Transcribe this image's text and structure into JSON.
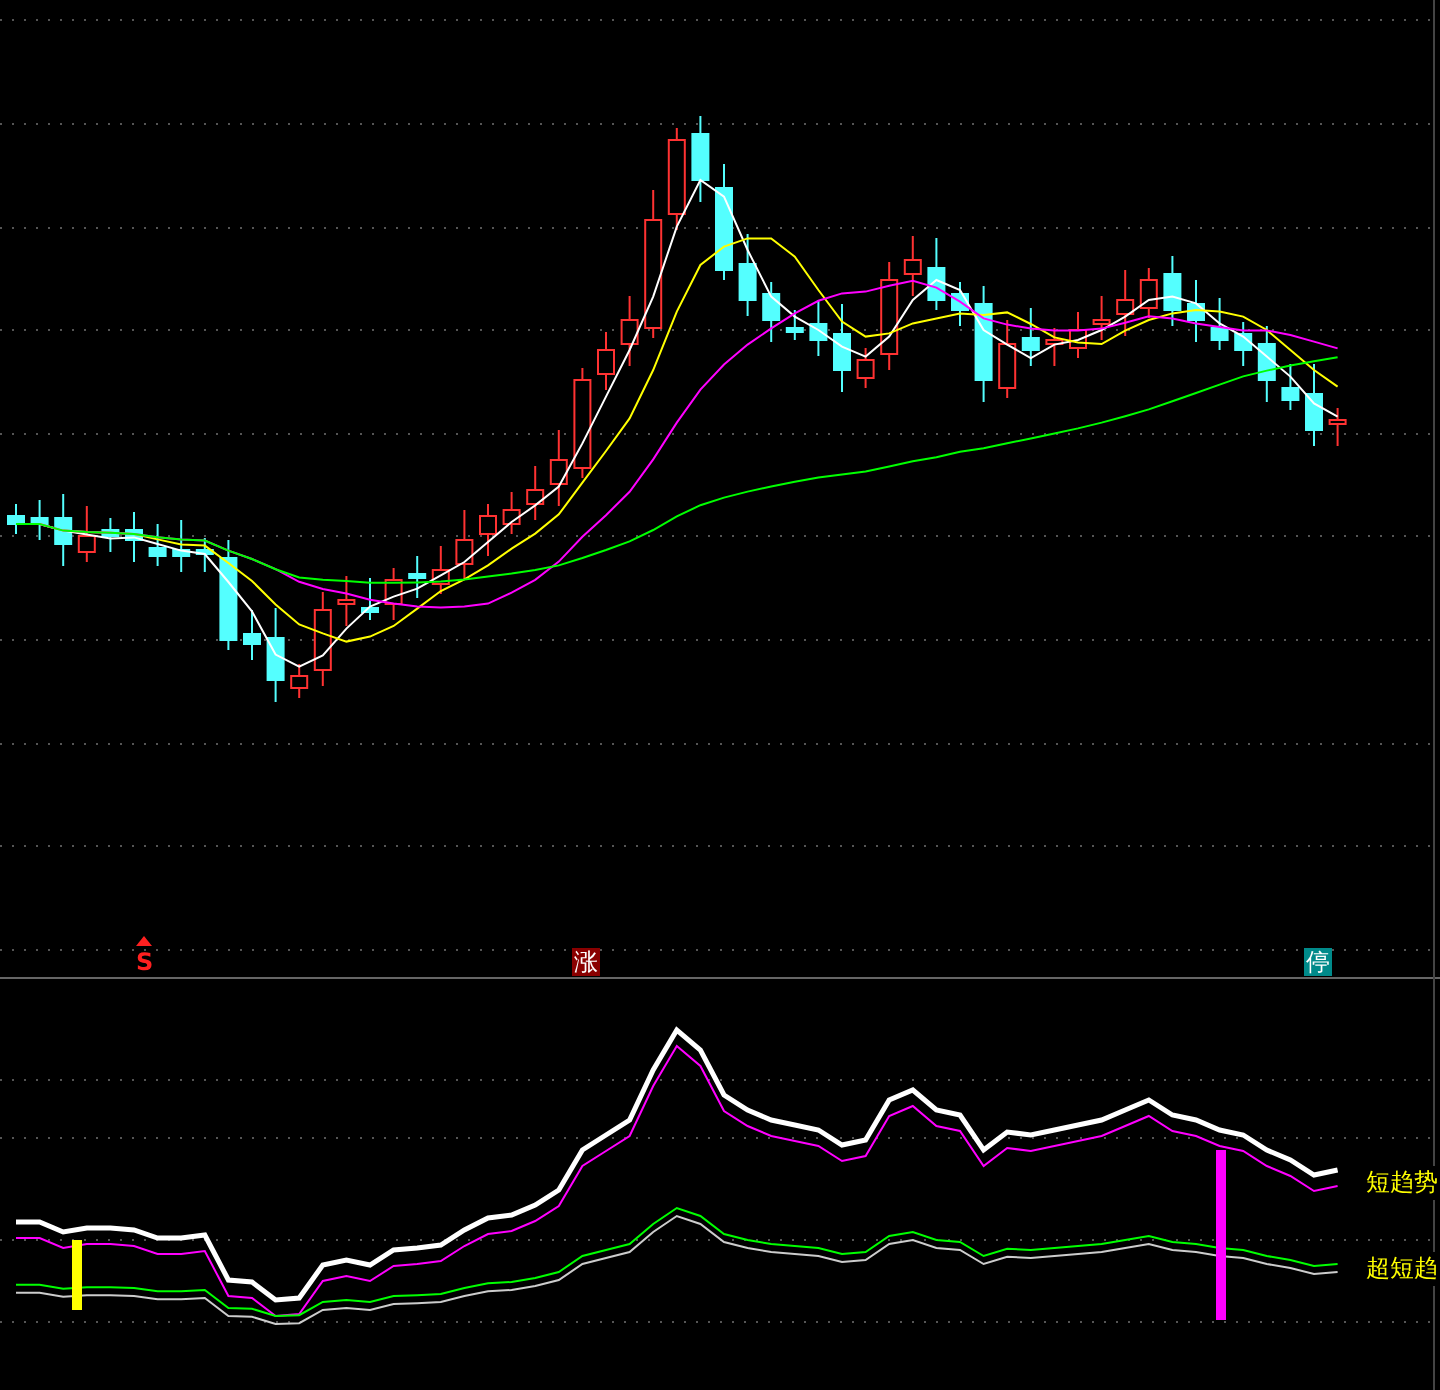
{
  "markers": [
    {
      "kind": "sell",
      "text": "S"
    },
    {
      "kind": "rise",
      "text": "涨"
    },
    {
      "kind": "halt",
      "text": "停"
    }
  ],
  "indicator_labels": [
    {
      "text": "短趋势"
    },
    {
      "text": "超短趋"
    }
  ]
}
